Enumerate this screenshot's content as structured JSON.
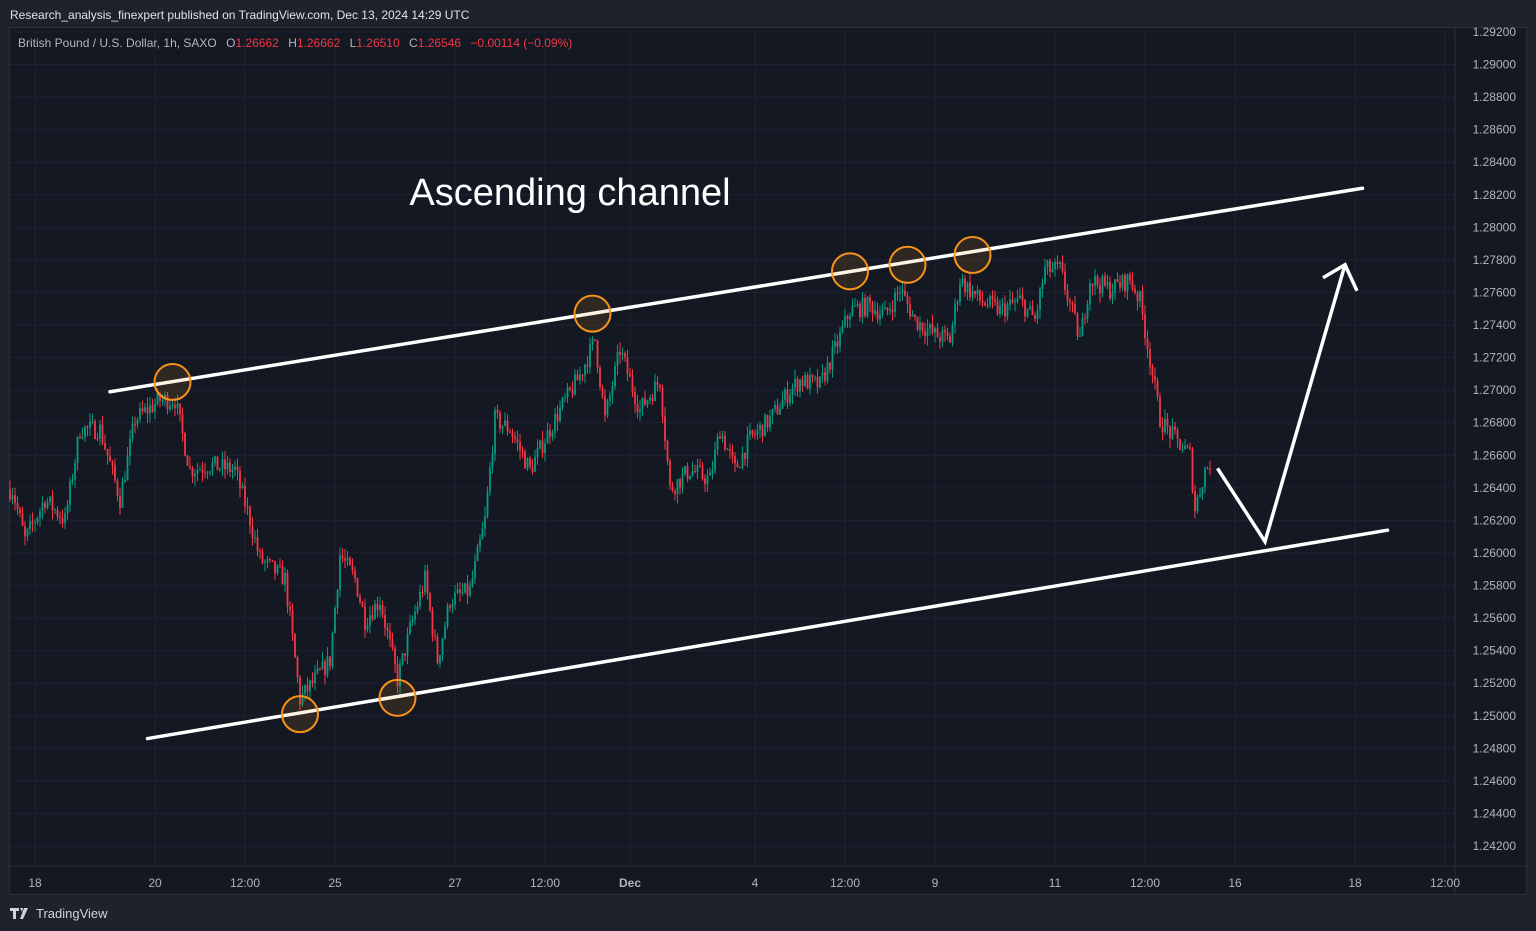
{
  "header": {
    "published": "Research_analysis_finexpert published on TradingView.com, Dec 13, 2024 14:29 UTC"
  },
  "legend": {
    "symbol": "British Pound / U.S. Dollar, 1h, SAXO",
    "o_label": "O",
    "o": "1.26662",
    "h_label": "H",
    "h": "1.26662",
    "l_label": "L",
    "l": "1.26510",
    "c_label": "C",
    "c": "1.26546",
    "change": "−0.00114 (−0.09%)"
  },
  "footer": {
    "brand": "TradingView"
  },
  "colors": {
    "up": "#089981",
    "down": "#f23645",
    "annotation": "#ffffff",
    "circle": "#f7931a"
  },
  "chart_data": {
    "type": "candlestick",
    "title": "Ascending channel",
    "ylim": [
      1.241,
      1.293
    ],
    "price_ticks": [
      "1.29200",
      "1.29000",
      "1.28800",
      "1.28600",
      "1.28400",
      "1.28200",
      "1.28000",
      "1.27800",
      "1.27600",
      "1.27400",
      "1.27200",
      "1.27000",
      "1.26800",
      "1.26600",
      "1.26400",
      "1.26200",
      "1.26000",
      "1.25800",
      "1.25600",
      "1.25400",
      "1.25200",
      "1.25000",
      "1.24800",
      "1.24600",
      "1.24400",
      "1.24200"
    ],
    "time_ticks": [
      {
        "bar": 10,
        "label": "18"
      },
      {
        "bar": 58,
        "label": "20"
      },
      {
        "bar": 94,
        "label": "12:00"
      },
      {
        "bar": 130,
        "label": "25"
      },
      {
        "bar": 178,
        "label": "27"
      },
      {
        "bar": 214,
        "label": "12:00"
      },
      {
        "bar": 248,
        "label": "Dec",
        "bold": true
      },
      {
        "bar": 298,
        "label": "4"
      },
      {
        "bar": 334,
        "label": "12:00"
      },
      {
        "bar": 370,
        "label": "9"
      },
      {
        "bar": 418,
        "label": "11"
      },
      {
        "bar": 454,
        "label": "12:00"
      },
      {
        "bar": 490,
        "label": "16"
      },
      {
        "bar": 538,
        "label": "18"
      },
      {
        "bar": 574,
        "label": "12:00"
      }
    ],
    "close_path": [
      [
        1,
        1.2639
      ],
      [
        6,
        1.2608
      ],
      [
        14,
        1.2633
      ],
      [
        22,
        1.262
      ],
      [
        28,
        1.2676
      ],
      [
        36,
        1.2676
      ],
      [
        44,
        1.2633
      ],
      [
        50,
        1.2682
      ],
      [
        60,
        1.2694
      ],
      [
        66,
        1.2694
      ],
      [
        72,
        1.2651
      ],
      [
        80,
        1.2654
      ],
      [
        90,
        1.2651
      ],
      [
        96,
        1.262
      ],
      [
        100,
        1.2596
      ],
      [
        110,
        1.2584
      ],
      [
        116,
        1.251
      ],
      [
        122,
        1.2522
      ],
      [
        128,
        1.2534
      ],
      [
        132,
        1.2599
      ],
      [
        138,
        1.2584
      ],
      [
        142,
        1.2559
      ],
      [
        148,
        1.2571
      ],
      [
        155,
        1.2522
      ],
      [
        160,
        1.2553
      ],
      [
        166,
        1.2584
      ],
      [
        171,
        1.2534
      ],
      [
        176,
        1.2571
      ],
      [
        184,
        1.2577
      ],
      [
        190,
        1.262
      ],
      [
        194,
        1.2682
      ],
      [
        200,
        1.2676
      ],
      [
        208,
        1.2651
      ],
      [
        214,
        1.267
      ],
      [
        220,
        1.2688
      ],
      [
        228,
        1.2709
      ],
      [
        234,
        1.2731
      ],
      [
        238,
        1.2682
      ],
      [
        244,
        1.2725
      ],
      [
        248,
        1.2706
      ],
      [
        252,
        1.2688
      ],
      [
        260,
        1.2706
      ],
      [
        264,
        1.2639
      ],
      [
        272,
        1.2651
      ],
      [
        280,
        1.2645
      ],
      [
        284,
        1.2676
      ],
      [
        290,
        1.2651
      ],
      [
        296,
        1.267
      ],
      [
        304,
        1.2682
      ],
      [
        312,
        1.27
      ],
      [
        316,
        1.2706
      ],
      [
        324,
        1.2703
      ],
      [
        330,
        1.2725
      ],
      [
        336,
        1.2749
      ],
      [
        344,
        1.2752
      ],
      [
        350,
        1.2746
      ],
      [
        356,
        1.2762
      ],
      [
        362,
        1.2743
      ],
      [
        370,
        1.2734
      ],
      [
        376,
        1.2731
      ],
      [
        380,
        1.2768
      ],
      [
        388,
        1.2755
      ],
      [
        396,
        1.2749
      ],
      [
        404,
        1.2755
      ],
      [
        410,
        1.2743
      ],
      [
        414,
        1.2774
      ],
      [
        420,
        1.2774
      ],
      [
        428,
        1.2731
      ],
      [
        432,
        1.2768
      ],
      [
        440,
        1.2762
      ],
      [
        448,
        1.2768
      ],
      [
        452,
        1.2755
      ],
      [
        456,
        1.2719
      ],
      [
        460,
        1.2682
      ],
      [
        466,
        1.267
      ],
      [
        472,
        1.266
      ],
      [
        474,
        1.2627
      ],
      [
        478,
        1.2651
      ],
      [
        480,
        1.2655
      ]
    ],
    "channel": {
      "upper": [
        [
          40,
          1.2699
        ],
        [
          541,
          1.2824
        ]
      ],
      "lower": [
        [
          55,
          1.2486
        ],
        [
          551,
          1.2614
        ]
      ]
    },
    "projection": [
      [
        483,
        1.2652
      ],
      [
        502,
        1.2607
      ],
      [
        534,
        1.2777
      ]
    ],
    "touch_points": [
      [
        65,
        1.2705
      ],
      [
        116,
        1.2501
      ],
      [
        155,
        1.2511
      ],
      [
        233,
        1.2747
      ],
      [
        336,
        1.2773
      ],
      [
        359,
        1.2777
      ],
      [
        385,
        1.2783
      ]
    ]
  }
}
